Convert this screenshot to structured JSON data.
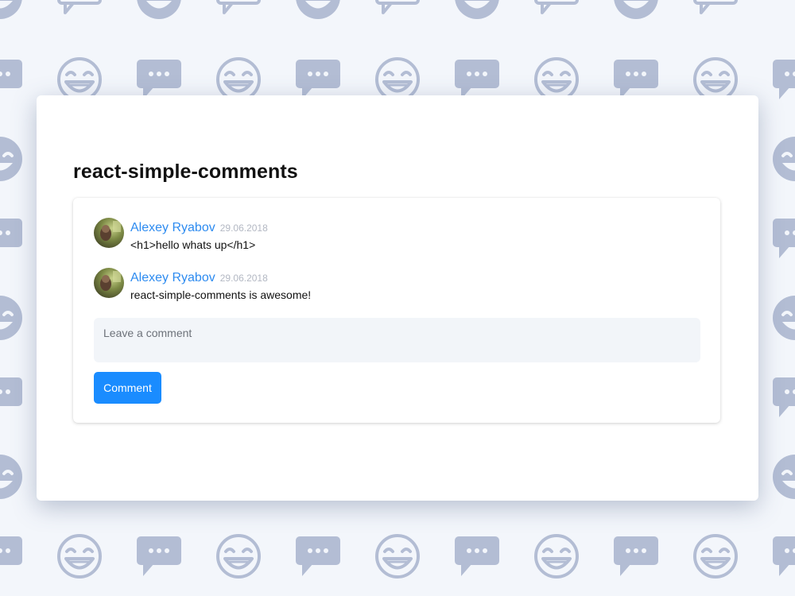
{
  "page": {
    "title": "react-simple-comments"
  },
  "comments": [
    {
      "author": "Alexey Ryabov",
      "date": "29.06.2018",
      "text": "<h1>hello whats up</h1>",
      "avatar_icon": "user-photo-avatar"
    },
    {
      "author": "Alexey Ryabov",
      "date": "29.06.2018",
      "text": "react-simple-comments is awesome!",
      "avatar_icon": "user-photo-avatar"
    }
  ],
  "form": {
    "placeholder": "Leave a comment",
    "value": "",
    "submit_label": "Comment"
  },
  "background": {
    "pattern_icons": [
      "smiley-face-icon",
      "speech-bubble-icon"
    ],
    "icon_color": "#b3bdd4",
    "base_color": "#f3f6fb"
  },
  "colors": {
    "accent": "#1a8cff",
    "author_link": "#2d8bf0",
    "date": "#b3b8c3",
    "input_bg": "#f2f5f9"
  }
}
